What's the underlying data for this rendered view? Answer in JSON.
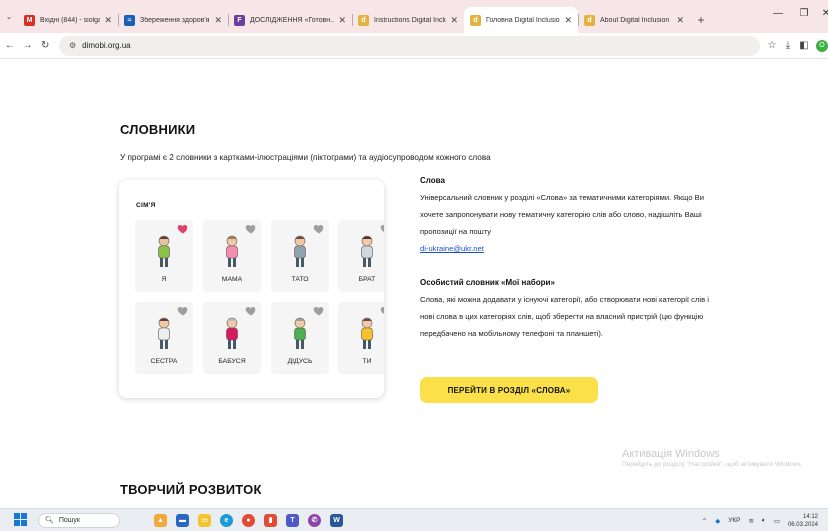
{
  "browser": {
    "tabs": [
      {
        "title": "Вхідні (844) - siolga1...",
        "fav": "M",
        "color": "#d93025",
        "active": false
      },
      {
        "title": "Збереження здоров'я ч...",
        "fav": "≈",
        "color": "#1b5fb8",
        "active": false
      },
      {
        "title": "ДОСЛІДЖЕННЯ «Готовн...",
        "fav": "F",
        "color": "#6b3fa0",
        "active": false
      },
      {
        "title": "Instructions Digital Inclusio...",
        "fav": "d",
        "color": "#e3b341",
        "active": false
      },
      {
        "title": "Головна Digital Inclusion",
        "fav": "d",
        "color": "#e3b341",
        "active": true
      },
      {
        "title": "About Digital Inclusion",
        "fav": "d",
        "color": "#e3b341",
        "active": false
      }
    ],
    "url": "dimobi.org.ua",
    "profile_letter": "O"
  },
  "page": {
    "section1_title": "СЛОВНИКИ",
    "intro": "У програмі є 2 словники з картками-ілюстраціями (піктограми) та аудіосупроводом кожного слова",
    "panel_label": "СІМ'Я",
    "cards": [
      {
        "word": "Я",
        "favorite": true
      },
      {
        "word": "МАМА",
        "favorite": false
      },
      {
        "word": "ТАТО",
        "favorite": false
      },
      {
        "word": "БРАТ",
        "favorite": false
      },
      {
        "word": "СЕСТРА",
        "favorite": false
      },
      {
        "word": "БАБУСЯ",
        "favorite": false
      },
      {
        "word": "ДІДУСЬ",
        "favorite": false
      },
      {
        "word": "ТИ",
        "favorite": false
      }
    ],
    "words_heading": "Слова",
    "words_text": "Універсальний словник у розділі «Слова» за тематичними категоріями. Якщо Ви хочете запропонувати нову тематичну категорію слів або слово, надішліть Ваші пропозиції на пошту",
    "words_email": "di-ukraine@ukr.net",
    "personal_heading": "Особистий словник «Мої набори»",
    "personal_text": "Слова, які можна додавати у існуючі категорії, або створювати нові категорії слів і нові слова в цих категоріях слів, щоб зберегти на власний пристрій (цю функцію передбачено на мобільному телефоні та планшеті).",
    "cta_label": "ПЕРЕЙТИ В РОЗДІЛ «СЛОВА»",
    "section2_title": "ТВОРЧИЙ РОЗВИТОК",
    "activation_title": "Активація Windows",
    "activation_text": "Перейдіть до розділу \"Настройки\", щоб активувати Windows."
  },
  "taskbar": {
    "search_placeholder": "Пошук",
    "lang": "УКР",
    "time": "14:12",
    "date": "06.03.2024"
  },
  "colors": {
    "accent_yellow": "#fbe04a",
    "heart_active": "#e2416b",
    "heart_inactive": "#9e9e9e",
    "link": "#1a4fd6"
  }
}
